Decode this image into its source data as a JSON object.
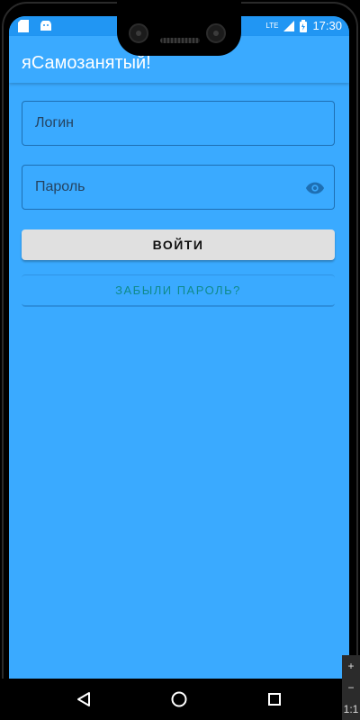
{
  "status_bar": {
    "time": "17:30",
    "network": "LTE",
    "left_icons": [
      "sd-card-icon",
      "android-debug-icon"
    ],
    "right_icons": [
      "wifi-icon",
      "signal-icon",
      "battery-icon"
    ]
  },
  "app": {
    "title": "яСамозанятый!",
    "background_color": "#3aaaff",
    "accent_color": "#1e6fb3"
  },
  "form": {
    "login_placeholder": "Логин",
    "login_value": "",
    "password_placeholder": "Пароль",
    "password_value": "",
    "password_visibility_icon": "eye-icon",
    "login_button_label": "ВОЙТИ",
    "forgot_button_label": "ЗАБЫЛИ ПАРОЛЬ?"
  },
  "nav": {
    "back_icon": "back-triangle-icon",
    "home_icon": "home-circle-icon",
    "recents_icon": "recents-square-icon"
  },
  "emulator": {
    "zoom_in": "+",
    "zoom_out": "−",
    "ratio": "1:1"
  }
}
